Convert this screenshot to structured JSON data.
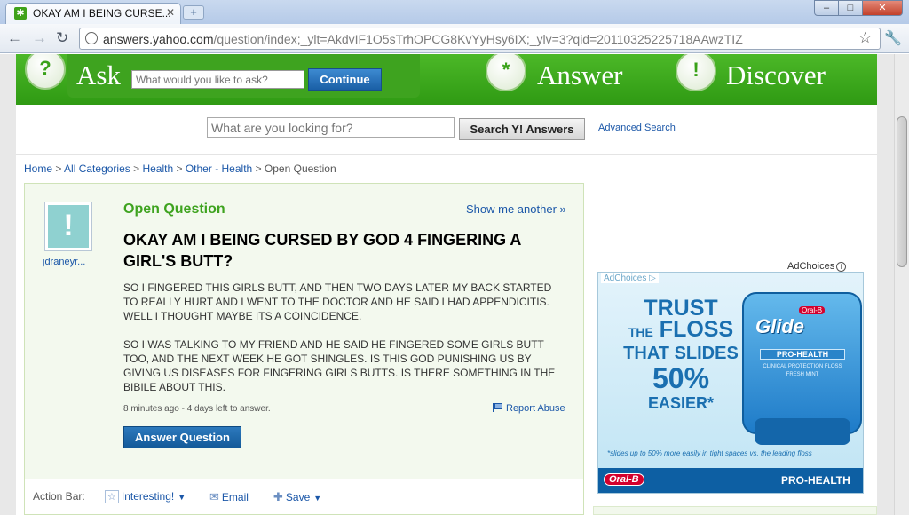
{
  "browser": {
    "tab_title": "OKAY AM I BEING CURSE...",
    "tab_close": "✕",
    "new_tab": "+",
    "favicon": "✱",
    "url_host": "answers.yahoo.com",
    "url_path": "/question/index;_ylt=AkdvIF1O5sTrhOPCG8KvYyHsy6IX;_ylv=3?qid=20110325225718AAwzTIZ",
    "window_controls": {
      "minimize": "–",
      "maximize": "□",
      "close": "✕"
    },
    "icons": {
      "back": "back-arrow-icon",
      "forward": "forward-arrow-icon",
      "reload": "reload-icon",
      "star": "bookmark-star-icon",
      "wrench": "wrench-icon"
    }
  },
  "banner": {
    "ask_word": "Ask",
    "ask_placeholder": "What would you like to ask?",
    "continue_label": "Continue",
    "answer_word": "Answer",
    "discover_word": "Discover",
    "smiley_ask": "?",
    "smiley_answer": "*",
    "smiley_discover": "!",
    "colors": {
      "green": "#3ea31f",
      "blue_button": "#1a5fa6"
    }
  },
  "search": {
    "placeholder": "What are you looking for?",
    "button_label": "Search Y! Answers",
    "advanced_label": "Advanced Search"
  },
  "breadcrumb": {
    "items": [
      "Home",
      "All Categories",
      "Health",
      "Other - Health"
    ],
    "current": "Open Question",
    "separator": ">"
  },
  "question": {
    "status": "Open Question",
    "show_another": "Show me another »",
    "username": "jdraneyr...",
    "avatar_glyph": "!",
    "title": "OKAY AM I BEING CURSED BY GOD 4 FINGERING A GIRL'S BUTT?",
    "body": [
      "SO I FINGERED THIS GIRLS BUTT, AND THEN TWO DAYS LATER MY BACK STARTED TO REALLY HURT AND I WENT TO THE DOCTOR AND HE SAID I HAD APPENDICITIS. WELL I THOUGHT MAYBE ITS A COINCIDENCE.",
      "SO I WAS TALKING TO MY FRIEND AND HE SAID HE FINGERED SOME GIRLS BUTT TOO, AND THE NEXT WEEK HE GOT SHINGLES. IS THIS GOD PUNISHING US BY GIVING US DISEASES FOR FINGERING GIRLS BUTTS. IS THERE SOMETHING IN THE BIBILE ABOUT THIS."
    ],
    "meta": "8 minutes ago - 4 days left to answer.",
    "report_abuse": "Report Abuse",
    "answer_button": "Answer Question"
  },
  "action_bar": {
    "label": "Action Bar:",
    "interesting": "Interesting!",
    "email": "Email",
    "save": "Save",
    "star_glyph": "☆",
    "email_glyph": "✉",
    "save_glyph": "✚"
  },
  "ad": {
    "adchoices_label": "AdChoices",
    "adchoices_inner": "AdChoices ▷",
    "line1": "TRUST",
    "line2_the": "THE",
    "line2": "FLOSS",
    "line3": "THAT SLIDES",
    "line4": "50%",
    "line5": "EASIER*",
    "brand": "Glide",
    "brand_small": "Oral-B",
    "pro_health": "PRO-HEALTH",
    "clinical": "CLINICAL PROTECTION FLOSS",
    "fresh_mint": "FRESH MINT",
    "footnote": "*slides up to 50% more easily in tight spaces vs. the leading floss",
    "oralb": "Oral-B",
    "pro_health_bottom": "PRO-HEALTH"
  }
}
